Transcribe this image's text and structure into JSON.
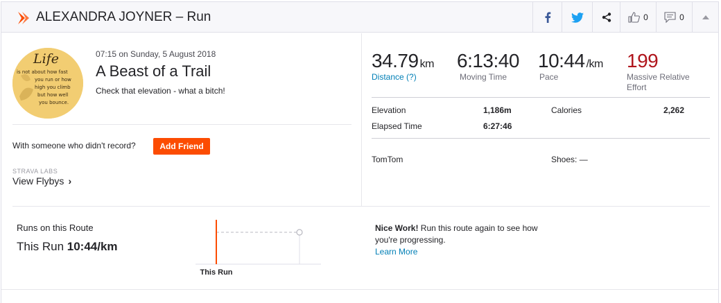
{
  "header": {
    "title": "ALEXANDRA JOYNER – Run",
    "kudos_count": "0",
    "comment_count": "0"
  },
  "activity": {
    "datetime": "07:15 on Sunday, 5 August 2018",
    "name": "A Beast of a Trail",
    "description": "Check that elevation - what a bitch!",
    "with_someone_text": "With someone who didn't record?",
    "add_friend_label": "Add Friend",
    "labs_label": "STRAVA LABS",
    "flybys_label": "View Flybys"
  },
  "avatar": {
    "line1": "Life",
    "line2": "is not about how fast",
    "line3": "you run or how",
    "line4": "high you climb",
    "line5": "but how well",
    "line6": "you bounce."
  },
  "stats": {
    "distance_value": "34.79",
    "distance_unit": "km",
    "distance_label": "Distance (?)",
    "moving_time_value": "6:13:40",
    "moving_time_label": "Moving Time",
    "pace_value": "10:44",
    "pace_unit": "/km",
    "pace_label": "Pace",
    "effort_value": "199",
    "effort_label_1": "Massive Relative",
    "effort_label_2": "Effort"
  },
  "details": {
    "elevation_label": "Elevation",
    "elevation_value": "1,186m",
    "calories_label": "Calories",
    "calories_value": "2,262",
    "elapsed_label": "Elapsed Time",
    "elapsed_value": "6:27:46",
    "device": "TomTom",
    "shoes": "Shoes: —"
  },
  "route": {
    "title": "Runs on this Route",
    "this_run_prefix": "This Run",
    "this_run_pace": "10:44/km",
    "chart_label": "This Run",
    "nice_work_bold": "Nice Work!",
    "nice_work_text": " Run this route again to see how you're progressing.",
    "learn_more": "Learn More"
  },
  "colors": {
    "brand_orange": "#fc4c02",
    "link_blue": "#007fb6",
    "effort_red": "#b0161d"
  },
  "icons": [
    "strava-logo-icon",
    "facebook-icon",
    "twitter-icon",
    "share-icon",
    "thumbs-up-icon",
    "comment-icon",
    "caret-up-icon",
    "chevron-right-icon"
  ]
}
